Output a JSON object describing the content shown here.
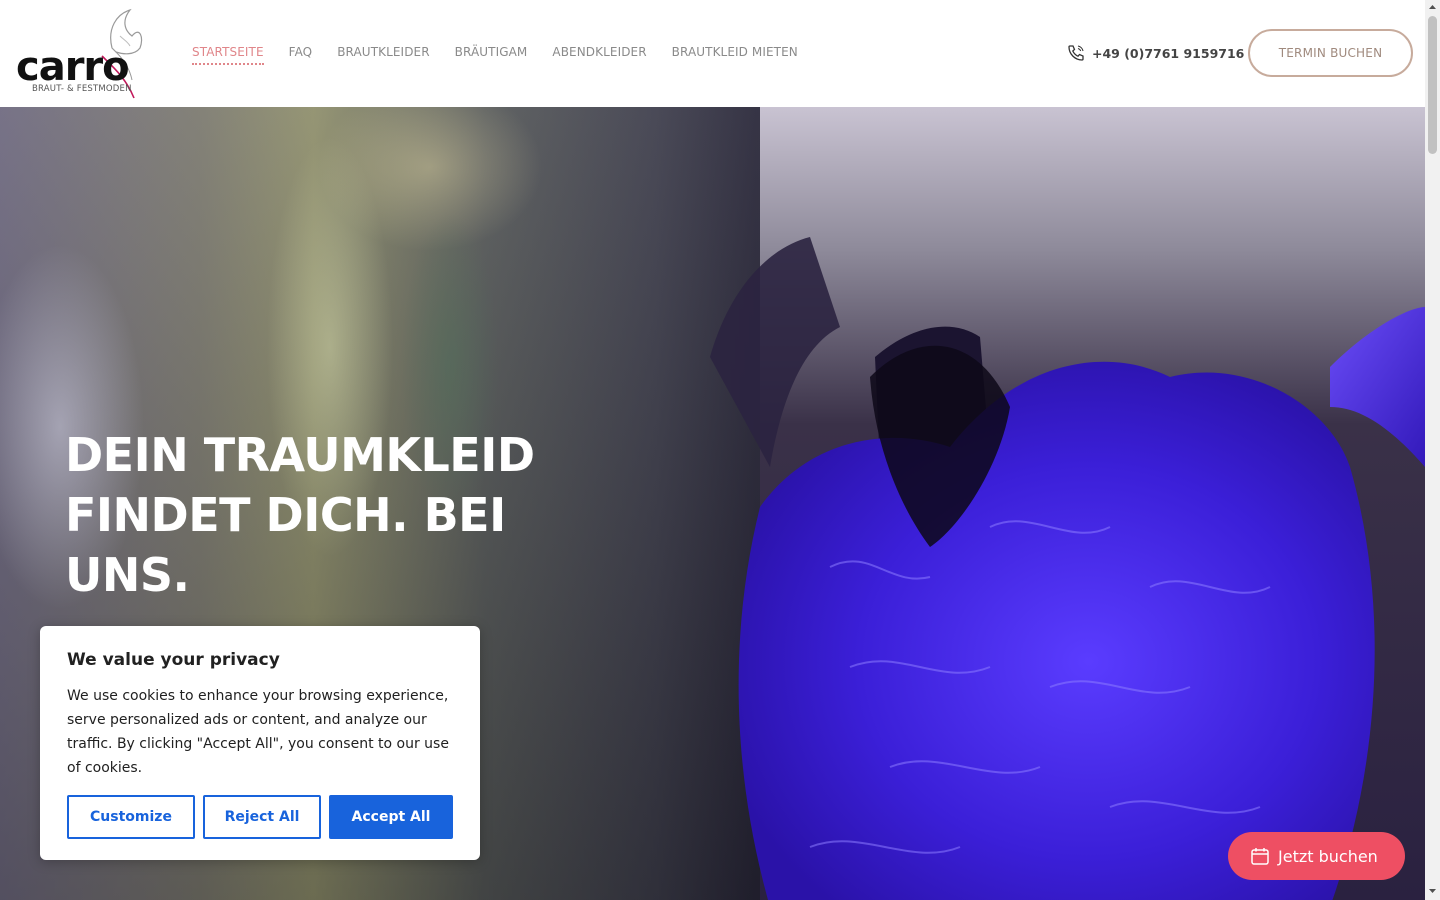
{
  "logo": {
    "name": "carro",
    "subtitle": "BRAUT- & FESTMODEN"
  },
  "nav": {
    "items": [
      {
        "label": "STARTSEITE",
        "active": true
      },
      {
        "label": "FAQ",
        "active": false
      },
      {
        "label": "BRAUTKLEIDER",
        "active": false
      },
      {
        "label": "BRÄUTIGAM",
        "active": false
      },
      {
        "label": "ABENDKLEIDER",
        "active": false
      },
      {
        "label": "BRAUTKLEID MIETEN",
        "active": false
      }
    ],
    "active_color": "#e0868a",
    "color": "#8a8a8a"
  },
  "header": {
    "phone": "+49 (0)7761 9159716",
    "phone_icon": "phone-icon",
    "cta_label": "TERMIN BUCHEN"
  },
  "hero": {
    "title": "DEIN TRAUMKLEID FINDET DICH. BEI UNS."
  },
  "cookie": {
    "title": "We value your privacy",
    "text": "We use cookies to enhance your browsing experience, serve personalized ads or content, and analyze our traffic. By clicking \"Accept All\", you consent to our use of cookies.",
    "customize_label": "Customize",
    "reject_label": "Reject All",
    "accept_label": "Accept All",
    "accent": "#1863dc"
  },
  "booking": {
    "label": "Jetzt buchen",
    "icon": "calendar-icon",
    "color": "#ee4f63"
  }
}
